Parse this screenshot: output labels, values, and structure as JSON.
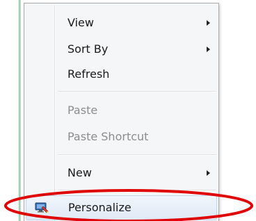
{
  "context_menu": {
    "items": [
      {
        "label": "View",
        "has_submenu": true,
        "enabled": true
      },
      {
        "label": "Sort By",
        "has_submenu": true,
        "enabled": true
      },
      {
        "label": "Refresh",
        "has_submenu": false,
        "enabled": true
      },
      {
        "label": "Paste",
        "has_submenu": false,
        "enabled": false
      },
      {
        "label": "Paste Shortcut",
        "has_submenu": false,
        "enabled": false
      },
      {
        "label": "New",
        "has_submenu": true,
        "enabled": true
      },
      {
        "label": "Personalize",
        "has_submenu": false,
        "enabled": true,
        "icon": "personalize-display-icon"
      }
    ]
  },
  "colors": {
    "annotation_ellipse": "#e00000",
    "menu_background": "#f5f6f7",
    "disabled_text": "#8d8d8d"
  }
}
